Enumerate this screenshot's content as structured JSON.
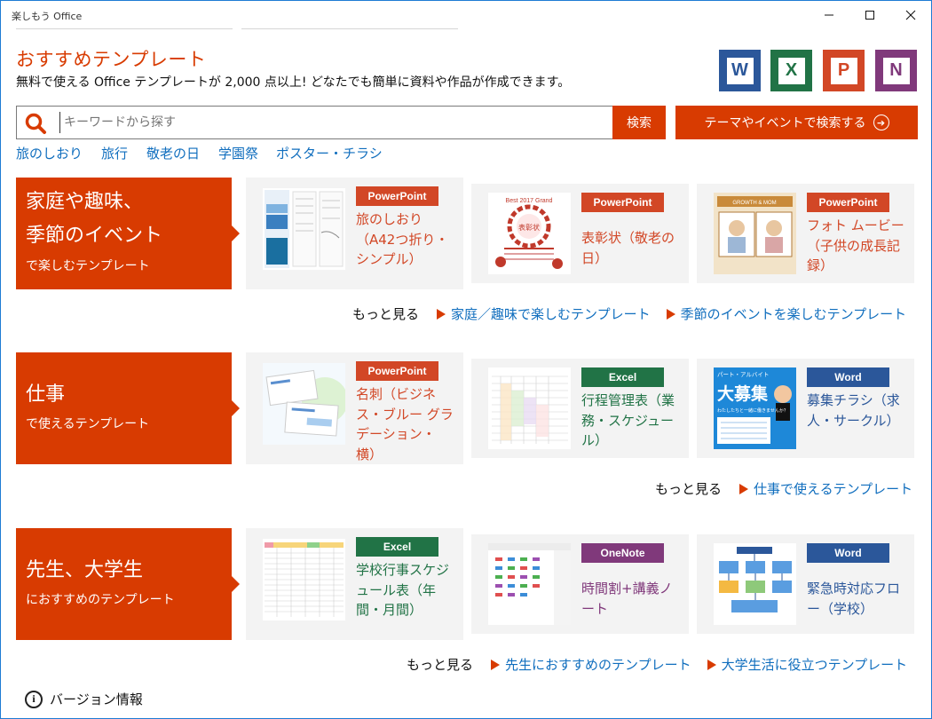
{
  "window": {
    "title": "楽しもう Office",
    "controls": {
      "minimize": "—",
      "maximize": "☐",
      "close": "✕"
    }
  },
  "header": {
    "title": "おすすめテンプレート",
    "subtitle": "無料で使える Office テンプレートが 2,000 点以上! どなたでも簡単に資料や作品が作成できます。",
    "apps": [
      {
        "letter": "W",
        "name": "Word",
        "color": "#2b579a"
      },
      {
        "letter": "X",
        "name": "Excel",
        "color": "#217346"
      },
      {
        "letter": "P",
        "name": "PowerPoint",
        "color": "#d24726"
      },
      {
        "letter": "N",
        "name": "OneNote",
        "color": "#80397b"
      }
    ]
  },
  "search": {
    "placeholder": "キーワードから探す",
    "button": "検索",
    "theme_button": "テーマやイベントで検索する"
  },
  "quick_links": [
    "旅のしおり",
    "旅行",
    "敬老の日",
    "学園祭",
    "ポスター・チラシ"
  ],
  "sections": [
    {
      "title_lines": [
        "家庭や趣味、",
        "季節のイベント"
      ],
      "subtitle": "で楽しむテンプレート",
      "cards": [
        {
          "app": "PowerPoint",
          "title": "旅のしおり（A42つ折り・シンプル）"
        },
        {
          "app": "PowerPoint",
          "title": "表彰状（敬老の日）"
        },
        {
          "app": "PowerPoint",
          "title": "フォト ムービー（子供の成長記録）"
        }
      ],
      "more_label": "もっと見る",
      "more_links": [
        "家庭／趣味で楽しむテンプレート",
        "季節のイベントを楽しむテンプレート"
      ]
    },
    {
      "title_lines": [
        "仕事"
      ],
      "subtitle": "で使えるテンプレート",
      "cards": [
        {
          "app": "PowerPoint",
          "title": "名刺（ビジネス・ブルー グラデーション・横）"
        },
        {
          "app": "Excel",
          "title": "行程管理表（業務・スケジュール）"
        },
        {
          "app": "Word",
          "title": "募集チラシ（求人・サークル）"
        }
      ],
      "more_label": "もっと見る",
      "more_links": [
        "仕事で使えるテンプレート"
      ]
    },
    {
      "title_lines": [
        "先生、大学生"
      ],
      "subtitle": "におすすめのテンプレート",
      "cards": [
        {
          "app": "Excel",
          "title": "学校行事スケジュール表（年間・月間）"
        },
        {
          "app": "OneNote",
          "title": "時間割+講義ノート"
        },
        {
          "app": "Word",
          "title": "緊急時対応フロー（学校）"
        }
      ],
      "more_label": "もっと見る",
      "more_links": [
        "先生におすすめのテンプレート",
        "大学生活に役立つテンプレート"
      ]
    }
  ],
  "thumbnails": {
    "award_heading": "Best 2017 Grand",
    "award_title": "表彰状",
    "photo_banner": "GROWTH & MOM",
    "recruit_tag": "パート・アルバイト",
    "recruit_title": "大募集",
    "recruit_sub": "わたしたちと一緒に働きませんか？"
  },
  "badge_colors": {
    "PowerPoint": "#d24726",
    "Excel": "#217346",
    "Word": "#2b579a",
    "OneNote": "#80397b"
  },
  "footer": {
    "version": "バージョン情報"
  }
}
